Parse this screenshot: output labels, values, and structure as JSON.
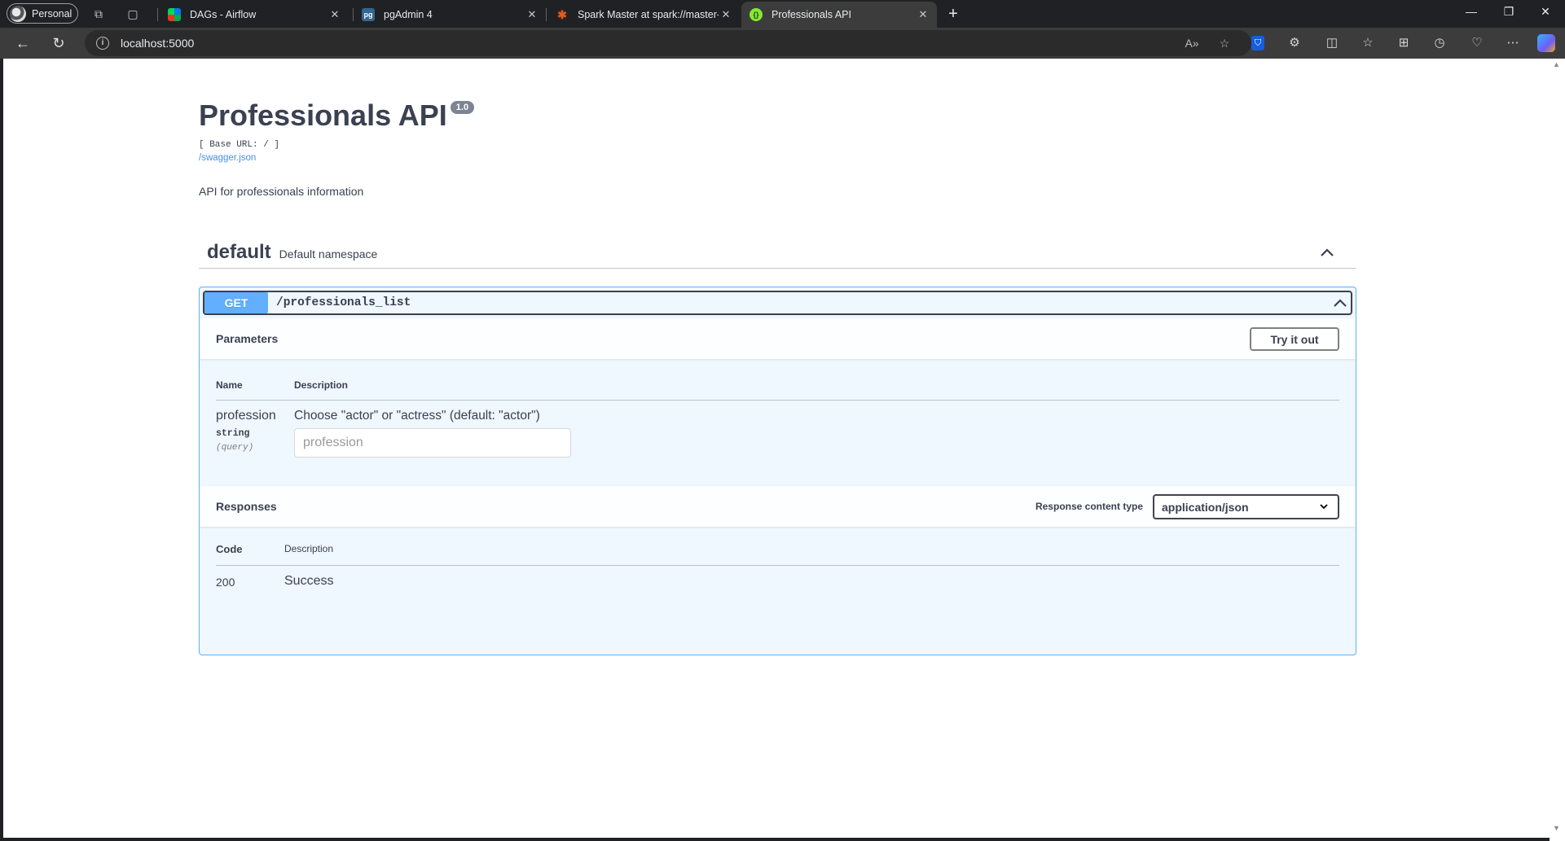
{
  "browser": {
    "profile_label": "Personal",
    "tabs": [
      {
        "title": "DAGs - Airflow",
        "favicon": "airflow-icon",
        "active": false
      },
      {
        "title": "pgAdmin 4",
        "favicon": "pgadmin-icon",
        "active": false
      },
      {
        "title": "Spark Master at spark://master-s",
        "favicon": "spark-icon",
        "active": false
      },
      {
        "title": "Professionals API",
        "favicon": "swagger-icon",
        "active": true
      }
    ],
    "url": "localhost:5000"
  },
  "api": {
    "title": "Professionals API",
    "version": "1.0",
    "base_url": "[ Base URL: / ]",
    "spec_link": "/swagger.json",
    "description": "API for professionals information"
  },
  "namespace": {
    "name": "default",
    "description": "Default namespace"
  },
  "operation": {
    "method": "GET",
    "path": "/professionals_list",
    "parameters_title": "Parameters",
    "try_button": "Try it out",
    "param_headers": {
      "name": "Name",
      "description": "Description"
    },
    "parameters": [
      {
        "name": "profession",
        "type": "string",
        "in": "(query)",
        "description": "Choose \"actor\" or \"actress\" (default: \"actor\")",
        "placeholder": "profession",
        "value": ""
      }
    ],
    "responses_title": "Responses",
    "response_content_type_label": "Response content type",
    "response_content_type": "application/json",
    "response_headers": {
      "code": "Code",
      "description": "Description"
    },
    "responses": [
      {
        "code": "200",
        "description": "Success"
      }
    ]
  },
  "colors": {
    "get_method": "#61affe",
    "text": "#3b4151",
    "link": "#4990e2",
    "version_badge": "#7d8492"
  }
}
